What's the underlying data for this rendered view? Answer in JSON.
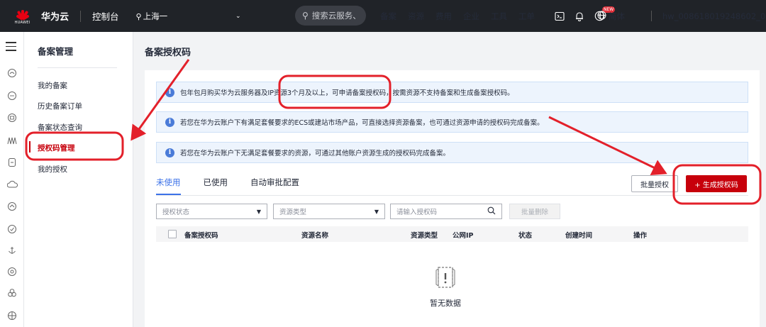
{
  "topbar": {
    "logo_text": "HUAWEI",
    "brand": "华为云",
    "console": "控制台",
    "region": "上海一",
    "search_placeholder": "搜索云服务、",
    "nav": [
      "备案",
      "资源",
      "费用",
      "企业",
      "工具",
      "工单"
    ],
    "new_badge": "NEW",
    "lang": "简体",
    "user": "hw_008618019248602_01"
  },
  "sidemenu": {
    "title": "备案管理",
    "items": [
      "我的备案",
      "历史备案订单",
      "备案状态查询",
      "授权码管理",
      "我的授权"
    ]
  },
  "page": {
    "title": "备案授权码",
    "notices": [
      "包年包月购买华为云服务器及IP资源3个月及以上，可申请备案授权码，按需资源不支持备案和生成备案授权码。",
      "若您在华为云账户下有满足套餐要求的ECS或建站市场产品，可直接选择资源备案，也可通过资源申请的授权码完成备案。",
      "若您在华为云账户下无满足套餐要求的资源，可通过其他账户资源生成的授权码完成备案。"
    ],
    "tabs": [
      "未使用",
      "已使用",
      "自动审批配置"
    ],
    "batch_auth": "批量授权",
    "generate": "+ 生成授权码",
    "filter_status": "授权状态",
    "filter_type": "资源类型",
    "search_placeholder": "请输入授权码",
    "batch_delete": "批量删除",
    "columns": [
      "备案授权码",
      "资源名称",
      "资源类型",
      "公网IP",
      "状态",
      "创建时间",
      "操作"
    ],
    "empty": "暂无数据"
  },
  "colors": {
    "brand_red": "#c7000b",
    "tab_blue": "#3c72e8",
    "annotation_red": "#e3202a"
  }
}
